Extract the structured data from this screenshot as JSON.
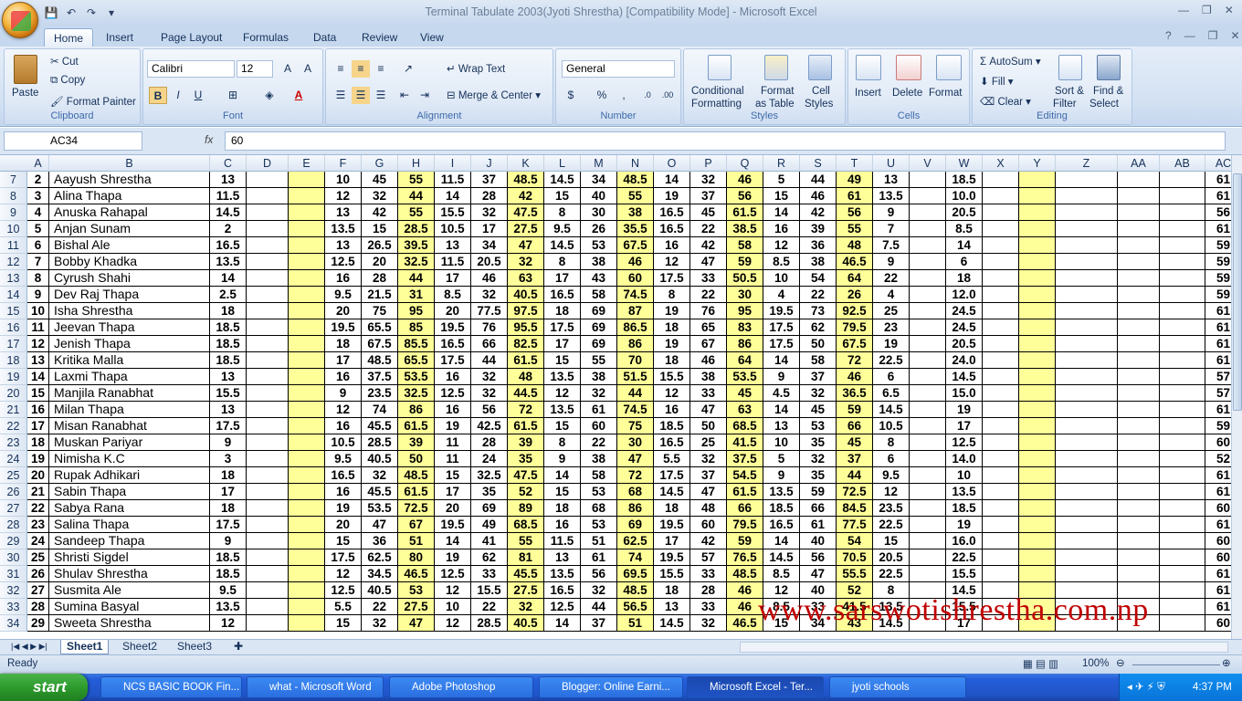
{
  "window": {
    "title": "Terminal Tabulate 2003(Jyoti Shrestha)  [Compatibility Mode] - Microsoft Excel"
  },
  "ribbon_tabs": [
    "Home",
    "Insert",
    "Page Layout",
    "Formulas",
    "Data",
    "Review",
    "View"
  ],
  "clipboard": {
    "paste": "Paste",
    "cut": "Cut",
    "copy": "Copy",
    "format_painter": "Format Painter",
    "label": "Clipboard"
  },
  "font": {
    "name": "Calibri",
    "size": "12",
    "label": "Font"
  },
  "alignment": {
    "wrap": "Wrap Text",
    "merge": "Merge & Center",
    "label": "Alignment"
  },
  "number": {
    "format": "General",
    "label": "Number"
  },
  "styles": {
    "cond": "Conditional",
    "cond2": "Formatting",
    "fmt_table": "Format",
    "fmt_table2": "as Table",
    "cell_styles": "Cell",
    "cell_styles2": "Styles",
    "label": "Styles"
  },
  "cells": {
    "insert": "Insert",
    "delete": "Delete",
    "format": "Format",
    "label": "Cells"
  },
  "editing": {
    "autosum": "AutoSum",
    "fill": "Fill",
    "clear": "Clear",
    "sort": "Sort &",
    "sort2": "Filter",
    "find": "Find &",
    "find2": "Select",
    "label": "Editing"
  },
  "formula_bar": {
    "name_box": "AC34",
    "fx": "fx",
    "value": "60"
  },
  "columns": [
    "A",
    "B",
    "C",
    "D",
    "E",
    "F",
    "G",
    "H",
    "I",
    "J",
    "K",
    "L",
    "M",
    "N",
    "O",
    "P",
    "Q",
    "R",
    "S",
    "T",
    "U",
    "V",
    "W",
    "X",
    "Y",
    "Z",
    "AA",
    "AB",
    "AC"
  ],
  "rows": [
    {
      "r": "7",
      "a": "2",
      "b": "Aayush Shrestha",
      "c": "13",
      "v": [
        "10",
        "45",
        "55",
        "11.5",
        "37",
        "48.5",
        "14.5",
        "34",
        "48.5",
        "14",
        "32",
        "46",
        "5",
        "44",
        "49",
        "13"
      ],
      "w": "18.5",
      "ac": "61"
    },
    {
      "r": "8",
      "a": "3",
      "b": "Alina Thapa",
      "c": "11.5",
      "v": [
        "12",
        "32",
        "44",
        "14",
        "28",
        "42",
        "15",
        "40",
        "55",
        "19",
        "37",
        "56",
        "15",
        "46",
        "61",
        "13.5"
      ],
      "w": "10.0",
      "ac": "61"
    },
    {
      "r": "9",
      "a": "4",
      "b": "Anuska Rahapal",
      "c": "14.5",
      "v": [
        "13",
        "42",
        "55",
        "15.5",
        "32",
        "47.5",
        "8",
        "30",
        "38",
        "16.5",
        "45",
        "61.5",
        "14",
        "42",
        "56",
        "9"
      ],
      "w": "20.5",
      "ac": "56"
    },
    {
      "r": "10",
      "a": "5",
      "b": "Anjan Sunam",
      "c": "2",
      "v": [
        "13.5",
        "15",
        "28.5",
        "10.5",
        "17",
        "27.5",
        "9.5",
        "26",
        "35.5",
        "16.5",
        "22",
        "38.5",
        "16",
        "39",
        "55",
        "7"
      ],
      "w": "8.5",
      "ac": "61"
    },
    {
      "r": "11",
      "a": "6",
      "b": "Bishal Ale",
      "c": "16.5",
      "v": [
        "13",
        "26.5",
        "39.5",
        "13",
        "34",
        "47",
        "14.5",
        "53",
        "67.5",
        "16",
        "42",
        "58",
        "12",
        "36",
        "48",
        "7.5"
      ],
      "w": "14",
      "ac": "59"
    },
    {
      "r": "12",
      "a": "7",
      "b": "Bobby Khadka",
      "c": "13.5",
      "v": [
        "12.5",
        "20",
        "32.5",
        "11.5",
        "20.5",
        "32",
        "8",
        "38",
        "46",
        "12",
        "47",
        "59",
        "8.5",
        "38",
        "46.5",
        "9"
      ],
      "w": "6",
      "ac": "59"
    },
    {
      "r": "13",
      "a": "8",
      "b": "Cyrush Shahi",
      "c": "14",
      "v": [
        "16",
        "28",
        "44",
        "17",
        "46",
        "63",
        "17",
        "43",
        "60",
        "17.5",
        "33",
        "50.5",
        "10",
        "54",
        "64",
        "22"
      ],
      "w": "18",
      "ac": "59"
    },
    {
      "r": "14",
      "a": "9",
      "b": "Dev Raj Thapa",
      "c": "2.5",
      "v": [
        "9.5",
        "21.5",
        "31",
        "8.5",
        "32",
        "40.5",
        "16.5",
        "58",
        "74.5",
        "8",
        "22",
        "30",
        "4",
        "22",
        "26",
        "4"
      ],
      "w": "12.0",
      "ac": "59"
    },
    {
      "r": "15",
      "a": "10",
      "b": "Isha Shrestha",
      "c": "18",
      "v": [
        "20",
        "75",
        "95",
        "20",
        "77.5",
        "97.5",
        "18",
        "69",
        "87",
        "19",
        "76",
        "95",
        "19.5",
        "73",
        "92.5",
        "25"
      ],
      "w": "24.5",
      "ac": "61"
    },
    {
      "r": "16",
      "a": "11",
      "b": "Jeevan Thapa",
      "c": "18.5",
      "v": [
        "19.5",
        "65.5",
        "85",
        "19.5",
        "76",
        "95.5",
        "17.5",
        "69",
        "86.5",
        "18",
        "65",
        "83",
        "17.5",
        "62",
        "79.5",
        "23"
      ],
      "w": "24.5",
      "ac": "61"
    },
    {
      "r": "17",
      "a": "12",
      "b": "Jenish Thapa",
      "c": "18.5",
      "v": [
        "18",
        "67.5",
        "85.5",
        "16.5",
        "66",
        "82.5",
        "17",
        "69",
        "86",
        "19",
        "67",
        "86",
        "17.5",
        "50",
        "67.5",
        "19"
      ],
      "w": "20.5",
      "ac": "61"
    },
    {
      "r": "18",
      "a": "13",
      "b": "Kritika Malla",
      "c": "18.5",
      "v": [
        "17",
        "48.5",
        "65.5",
        "17.5",
        "44",
        "61.5",
        "15",
        "55",
        "70",
        "18",
        "46",
        "64",
        "14",
        "58",
        "72",
        "22.5"
      ],
      "w": "24.0",
      "ac": "61"
    },
    {
      "r": "19",
      "a": "14",
      "b": "Laxmi Thapa",
      "c": "13",
      "v": [
        "16",
        "37.5",
        "53.5",
        "16",
        "32",
        "48",
        "13.5",
        "38",
        "51.5",
        "15.5",
        "38",
        "53.5",
        "9",
        "37",
        "46",
        "6"
      ],
      "w": "14.5",
      "ac": "57"
    },
    {
      "r": "20",
      "a": "15",
      "b": "Manjila Ranabhat",
      "c": "15.5",
      "v": [
        "9",
        "23.5",
        "32.5",
        "12.5",
        "32",
        "44.5",
        "12",
        "32",
        "44",
        "12",
        "33",
        "45",
        "4.5",
        "32",
        "36.5",
        "6.5"
      ],
      "w": "15.0",
      "ac": "57"
    },
    {
      "r": "21",
      "a": "16",
      "b": "Milan Thapa",
      "c": "13",
      "v": [
        "12",
        "74",
        "86",
        "16",
        "56",
        "72",
        "13.5",
        "61",
        "74.5",
        "16",
        "47",
        "63",
        "14",
        "45",
        "59",
        "14.5"
      ],
      "w": "19",
      "ac": "61"
    },
    {
      "r": "22",
      "a": "17",
      "b": "Misan Ranabhat",
      "c": "17.5",
      "v": [
        "16",
        "45.5",
        "61.5",
        "19",
        "42.5",
        "61.5",
        "15",
        "60",
        "75",
        "18.5",
        "50",
        "68.5",
        "13",
        "53",
        "66",
        "10.5"
      ],
      "w": "17",
      "ac": "59"
    },
    {
      "r": "23",
      "a": "18",
      "b": "Muskan Pariyar",
      "c": "9",
      "v": [
        "10.5",
        "28.5",
        "39",
        "11",
        "28",
        "39",
        "8",
        "22",
        "30",
        "16.5",
        "25",
        "41.5",
        "10",
        "35",
        "45",
        "8"
      ],
      "w": "12.5",
      "ac": "60"
    },
    {
      "r": "24",
      "a": "19",
      "b": "Nimisha K.C",
      "c": "3",
      "v": [
        "9.5",
        "40.5",
        "50",
        "11",
        "24",
        "35",
        "9",
        "38",
        "47",
        "5.5",
        "32",
        "37.5",
        "5",
        "32",
        "37",
        "6"
      ],
      "w": "14.0",
      "ac": "52"
    },
    {
      "r": "25",
      "a": "20",
      "b": "Rupak Adhikari",
      "c": "18",
      "v": [
        "16.5",
        "32",
        "48.5",
        "15",
        "32.5",
        "47.5",
        "14",
        "58",
        "72",
        "17.5",
        "37",
        "54.5",
        "9",
        "35",
        "44",
        "9.5"
      ],
      "w": "10",
      "ac": "61"
    },
    {
      "r": "26",
      "a": "21",
      "b": "Sabin Thapa",
      "c": "17",
      "v": [
        "16",
        "45.5",
        "61.5",
        "17",
        "35",
        "52",
        "15",
        "53",
        "68",
        "14.5",
        "47",
        "61.5",
        "13.5",
        "59",
        "72.5",
        "12"
      ],
      "w": "13.5",
      "ac": "61"
    },
    {
      "r": "27",
      "a": "22",
      "b": "Sabya Rana",
      "c": "18",
      "v": [
        "19",
        "53.5",
        "72.5",
        "20",
        "69",
        "89",
        "18",
        "68",
        "86",
        "18",
        "48",
        "66",
        "18.5",
        "66",
        "84.5",
        "23.5"
      ],
      "w": "18.5",
      "ac": "60"
    },
    {
      "r": "28",
      "a": "23",
      "b": "Salina Thapa",
      "c": "17.5",
      "v": [
        "20",
        "47",
        "67",
        "19.5",
        "49",
        "68.5",
        "16",
        "53",
        "69",
        "19.5",
        "60",
        "79.5",
        "16.5",
        "61",
        "77.5",
        "22.5"
      ],
      "w": "19",
      "ac": "61"
    },
    {
      "r": "29",
      "a": "24",
      "b": "Sandeep Thapa",
      "c": "9",
      "v": [
        "15",
        "36",
        "51",
        "14",
        "41",
        "55",
        "11.5",
        "51",
        "62.5",
        "17",
        "42",
        "59",
        "14",
        "40",
        "54",
        "15"
      ],
      "w": "16.0",
      "ac": "60"
    },
    {
      "r": "30",
      "a": "25",
      "b": "Shristi Sigdel",
      "c": "18.5",
      "v": [
        "17.5",
        "62.5",
        "80",
        "19",
        "62",
        "81",
        "13",
        "61",
        "74",
        "19.5",
        "57",
        "76.5",
        "14.5",
        "56",
        "70.5",
        "20.5"
      ],
      "w": "22.5",
      "ac": "60"
    },
    {
      "r": "31",
      "a": "26",
      "b": "Shulav Shrestha",
      "c": "18.5",
      "v": [
        "12",
        "34.5",
        "46.5",
        "12.5",
        "33",
        "45.5",
        "13.5",
        "56",
        "69.5",
        "15.5",
        "33",
        "48.5",
        "8.5",
        "47",
        "55.5",
        "22.5"
      ],
      "w": "15.5",
      "ac": "61"
    },
    {
      "r": "32",
      "a": "27",
      "b": "Susmita Ale",
      "c": "9.5",
      "v": [
        "12.5",
        "40.5",
        "53",
        "12",
        "15.5",
        "27.5",
        "16.5",
        "32",
        "48.5",
        "18",
        "28",
        "46",
        "12",
        "40",
        "52",
        "8"
      ],
      "w": "14.5",
      "ac": "61"
    },
    {
      "r": "33",
      "a": "28",
      "b": "Sumina Basyal",
      "c": "13.5",
      "v": [
        "5.5",
        "22",
        "27.5",
        "10",
        "22",
        "32",
        "12.5",
        "44",
        "56.5",
        "13",
        "33",
        "46",
        "8.5",
        "33",
        "41.5",
        "13.5"
      ],
      "w": "15.5",
      "ac": "61"
    },
    {
      "r": "34",
      "a": "29",
      "b": "Sweeta Shrestha",
      "c": "12",
      "v": [
        "15",
        "32",
        "47",
        "12",
        "28.5",
        "40.5",
        "14",
        "37",
        "51",
        "14.5",
        "32",
        "46.5",
        "15",
        "34",
        "43",
        "14.5"
      ],
      "w": "17",
      "ac": "60"
    }
  ],
  "watermark": "www.sarswotishrestha.com.np",
  "sheets": [
    "Sheet1",
    "Sheet2",
    "Sheet3"
  ],
  "status": {
    "ready": "Ready",
    "zoom": "100%"
  },
  "taskbar": {
    "start": "start",
    "items": [
      "NCS BASIC BOOK Fin...",
      "what - Microsoft Word",
      "Adobe Photoshop",
      "Blogger: Online Earni...",
      "Microsoft Excel - Ter...",
      "jyoti schools"
    ],
    "clock": "4:37 PM"
  },
  "colors": {
    "highlight": "#ffff99",
    "ribbon": "#d3e1f3",
    "taskbar": "#245edb",
    "watermark": "#c00000"
  }
}
